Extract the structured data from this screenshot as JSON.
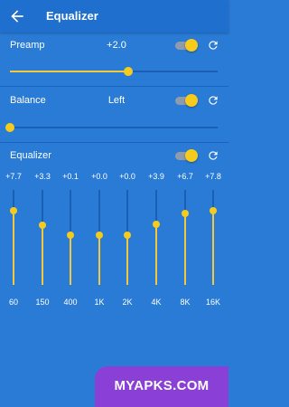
{
  "app_bar": {
    "title": "Equalizer",
    "back_icon": "arrow-back-icon"
  },
  "colors": {
    "background": "#2a7bd6",
    "app_bar": "#1e6fce",
    "accent": "#f7cb1c",
    "toggle_track": "#8e9bad",
    "watermark": "#8a3fd6"
  },
  "preamp": {
    "label": "Preamp",
    "value": "+2.0",
    "enabled": true,
    "level": 0.57,
    "reset_icon": "refresh-icon"
  },
  "balance": {
    "label": "Balance",
    "value": "Left",
    "enabled": true,
    "level": 0.0,
    "reset_icon": "refresh-icon"
  },
  "equalizer": {
    "label": "Equalizer",
    "enabled": true,
    "reset_icon": "refresh-icon",
    "bands": [
      {
        "freq": "60",
        "gain": "+7.7",
        "level": 0.78
      },
      {
        "freq": "150",
        "gain": "+3.3",
        "level": 0.63
      },
      {
        "freq": "400",
        "gain": "+0.1",
        "level": 0.52
      },
      {
        "freq": "1K",
        "gain": "+0.0",
        "level": 0.52
      },
      {
        "freq": "2K",
        "gain": "+0.0",
        "level": 0.52
      },
      {
        "freq": "4K",
        "gain": "+3.9",
        "level": 0.64
      },
      {
        "freq": "8K",
        "gain": "+6.7",
        "level": 0.75
      },
      {
        "freq": "16K",
        "gain": "+7.8",
        "level": 0.78
      }
    ]
  },
  "watermark": {
    "text": "MYAPKS.COM"
  }
}
